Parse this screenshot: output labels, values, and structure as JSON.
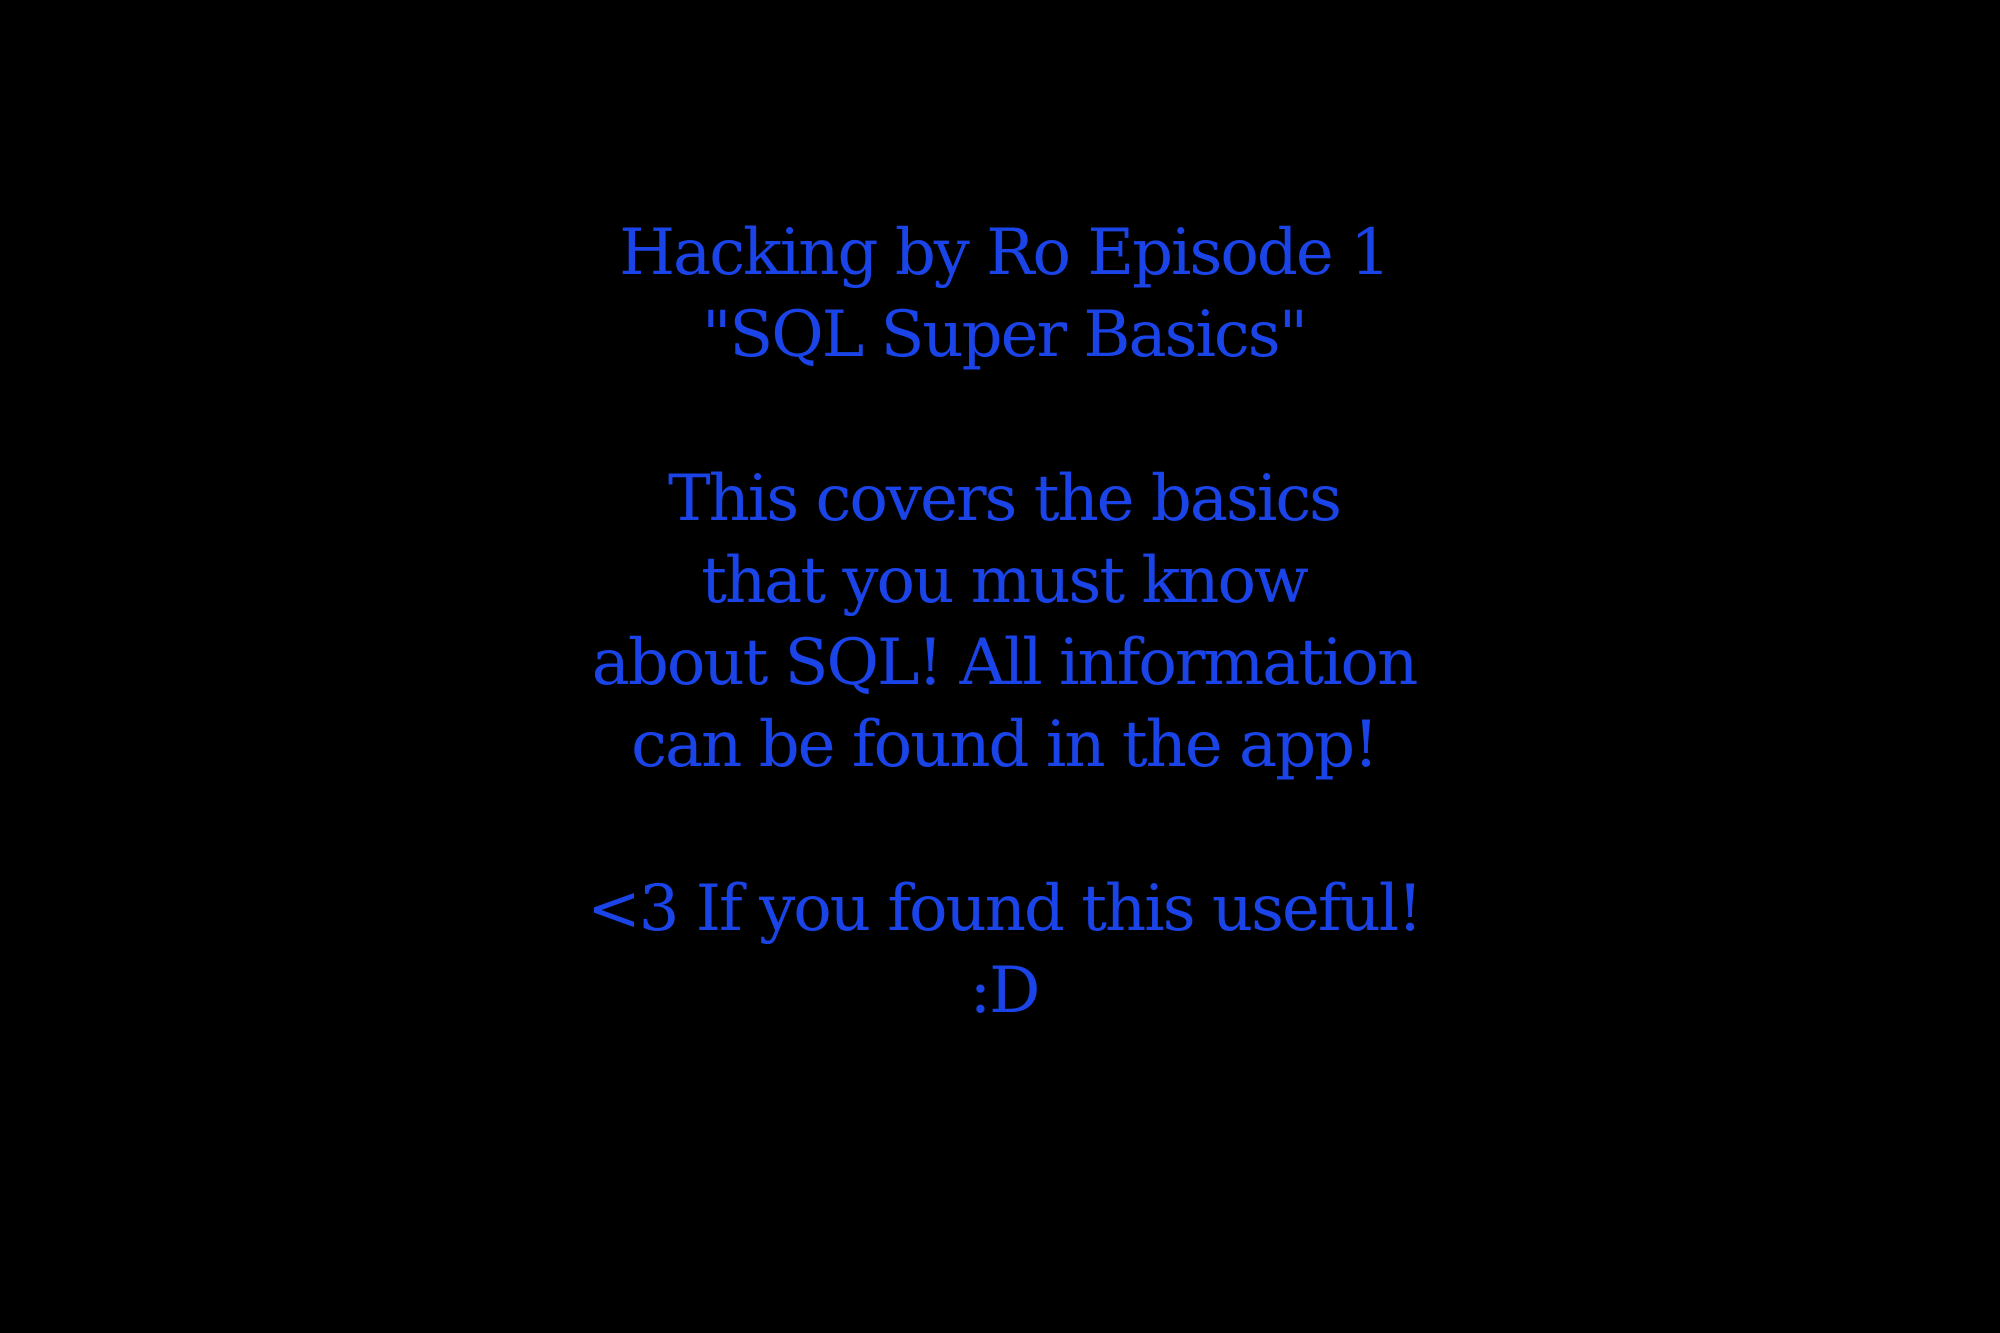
{
  "slide": {
    "background_color": "#000000",
    "text_color": "#1a44e8",
    "title_line_1": "Hacking by Ro Episode 1",
    "title_line_2": "\"SQL Super Basics\"",
    "body_line_1": "This covers the basics",
    "body_line_2": "that you must know",
    "body_line_3": "about SQL! All information",
    "body_line_4": "can be found in the app!",
    "closing_line_1": "<3 If you found this useful!",
    "closing_line_2": ":D"
  }
}
